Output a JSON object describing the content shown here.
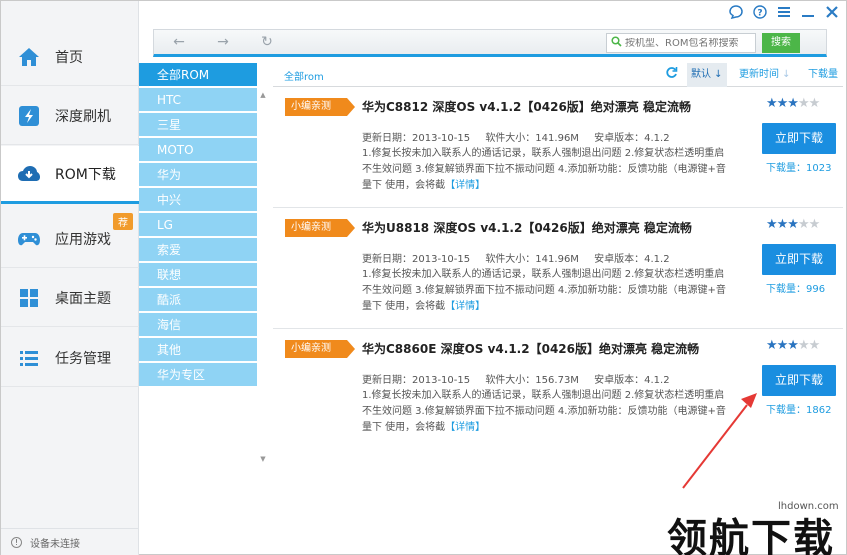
{
  "window": {
    "controls": [
      {
        "name": "feedback-icon",
        "glyph": "◯"
      },
      {
        "name": "help-icon",
        "glyph": "?"
      },
      {
        "name": "menu-icon",
        "glyph": "≡"
      },
      {
        "name": "minimize-icon",
        "glyph": "—"
      },
      {
        "name": "close-icon",
        "glyph": "✕"
      }
    ]
  },
  "sidebar": {
    "items": [
      {
        "label": "首页",
        "icon": "home-icon"
      },
      {
        "label": "深度刷机",
        "icon": "flash-icon"
      },
      {
        "label": "ROM下载",
        "icon": "cloud-download-icon",
        "active": true
      },
      {
        "label": "应用游戏",
        "icon": "gamepad-icon",
        "badge": "荐"
      },
      {
        "label": "桌面主题",
        "icon": "grid-icon"
      },
      {
        "label": "任务管理",
        "icon": "list-icon"
      }
    ],
    "status": "设备未连接"
  },
  "toolbar": {
    "back": "←",
    "forward": "→",
    "refresh": "↻",
    "search_placeholder": "按机型、ROM包名称搜索",
    "search_button": "搜索"
  },
  "categories": [
    "全部ROM",
    "HTC",
    "三星",
    "MOTO",
    "华为",
    "中兴",
    "LG",
    "索爱",
    "联想",
    "酷派",
    "海信",
    "其他",
    "华为专区"
  ],
  "list_header": {
    "breadcrumb": "全部rom",
    "sort_default": "默认",
    "sort_update": "更新时间",
    "sort_downloads": "下载量"
  },
  "roms": [
    {
      "tag": "小编亲测",
      "title": "华为C8812 深度OS v4.1.2【0426版】绝对漂亮 稳定流畅",
      "date": "更新日期：2013-10-15",
      "size": "软件大小：141.96M",
      "android": "安卓版本：4.1.2",
      "desc": "1.修复长按未加入联系人的通话记录，联系人强制退出问题 2.修复状态栏透明重启不生效问题 3.修复解锁界面下拉不振动问题 4.添加新功能：反馈功能（电源键+音量下 使用，会将截",
      "more": "【详情】",
      "rating": 3,
      "download_label": "立即下载",
      "downloads": "下载量：1023"
    },
    {
      "tag": "小编亲测",
      "title": "华为U8818 深度OS v4.1.2【0426版】绝对漂亮 稳定流畅",
      "date": "更新日期：2013-10-15",
      "size": "软件大小：141.96M",
      "android": "安卓版本：4.1.2",
      "desc": "1.修复长按未加入联系人的通话记录，联系人强制退出问题 2.修复状态栏透明重启不生效问题 3.修复解锁界面下拉不振动问题 4.添加新功能：反馈功能（电源键+音量下 使用，会将截",
      "more": "【详情】",
      "rating": 3,
      "download_label": "立即下载",
      "downloads": "下载量：996"
    },
    {
      "tag": "小编亲测",
      "title": "华为C8860E 深度OS v4.1.2【0426版】绝对漂亮 稳定流畅",
      "date": "更新日期：2013-10-15",
      "size": "软件大小：156.73M",
      "android": "安卓版本：4.1.2",
      "desc": "1.修复长按未加入联系人的通话记录，联系人强制退出问题 2.修复状态栏透明重启不生效问题 3.修复解锁界面下拉不振动问题 4.添加新功能：反馈功能（电源键+音量下 使用，会将截",
      "more": "【详情】",
      "rating": 3,
      "download_label": "立即下载",
      "downloads": "下载量：1862"
    }
  ],
  "watermark": {
    "site": "lhdown.com",
    "logo": "领航下载"
  },
  "colors": {
    "accent": "#1e9ce0",
    "tag": "#f08a1c",
    "category_bg": "#8fd3f4",
    "search_green": "#4cb648",
    "arrow_red": "#e53935"
  }
}
